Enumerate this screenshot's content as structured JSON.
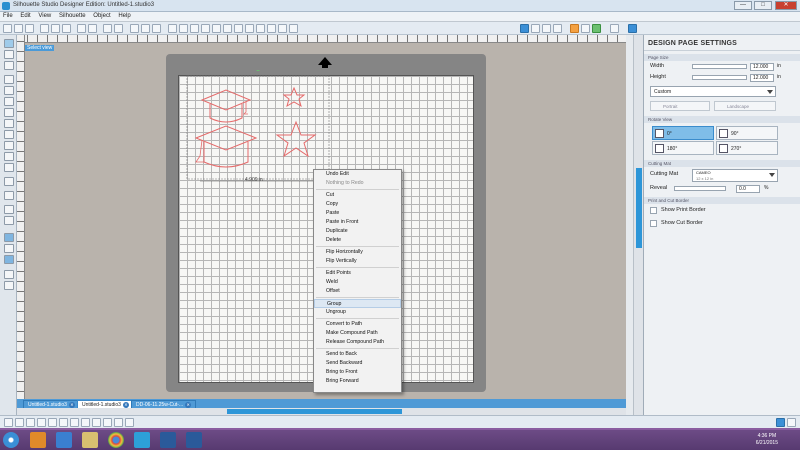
{
  "window": {
    "title": "Silhouette Studio Designer Edition: Untitled-1.studio3",
    "minimize": "—",
    "maximize": "□",
    "close": "✕"
  },
  "menu": [
    "File",
    "Edit",
    "View",
    "Silhouette",
    "Object",
    "Help"
  ],
  "workspace": {
    "view_tag": "Select view",
    "dimension_label": "4.909 in",
    "ruler_top_numbers": [
      "1",
      "2",
      "3",
      "4",
      "5",
      "6",
      "7",
      "8",
      "9",
      "10",
      "11",
      "12",
      "13",
      "14"
    ]
  },
  "context_menu": {
    "items": [
      {
        "label": "Undo Edit",
        "enabled": true
      },
      {
        "label": "Nothing to Redo",
        "enabled": false
      },
      {
        "sep": true
      },
      {
        "label": "Cut",
        "enabled": true
      },
      {
        "label": "Copy",
        "enabled": true
      },
      {
        "label": "Paste",
        "enabled": true
      },
      {
        "label": "Paste in Front",
        "enabled": true
      },
      {
        "label": "Duplicate",
        "enabled": true
      },
      {
        "label": "Delete",
        "enabled": true
      },
      {
        "sep": true
      },
      {
        "label": "Flip Horizontally",
        "enabled": true
      },
      {
        "label": "Flip Vertically",
        "enabled": true
      },
      {
        "sep": true
      },
      {
        "label": "Edit Points",
        "enabled": true
      },
      {
        "label": "Weld",
        "enabled": true
      },
      {
        "label": "Offset",
        "enabled": true
      },
      {
        "sep": true
      },
      {
        "label": "Group",
        "enabled": true,
        "highlighted": true
      },
      {
        "label": "Ungroup",
        "enabled": true
      },
      {
        "sep": true
      },
      {
        "label": "Convert to Path",
        "enabled": true
      },
      {
        "label": "Make Compound Path",
        "enabled": true
      },
      {
        "label": "Release Compound Path",
        "enabled": true
      },
      {
        "sep": true
      },
      {
        "label": "Send to Back",
        "enabled": true
      },
      {
        "label": "Send Backward",
        "enabled": true
      },
      {
        "label": "Bring to Front",
        "enabled": true
      },
      {
        "label": "Bring Forward",
        "enabled": true
      }
    ]
  },
  "tabs": [
    {
      "label": "Untitled-1.studio3",
      "active": false
    },
    {
      "label": "Untitled-1.studio3",
      "active": true
    },
    {
      "label": "DD-06-11.25w-Cut-...",
      "active": false
    }
  ],
  "panel": {
    "title": "DESIGN PAGE SETTINGS",
    "page_size": {
      "header": "Page Size",
      "width_label": "Width",
      "width_value": "12.000",
      "width_unit": "in",
      "height_label": "Height",
      "height_value": "12.000",
      "height_unit": "in",
      "preset": "Custom",
      "portrait": "Portrait",
      "landscape": "Landscape"
    },
    "rotate_view": {
      "header": "Rotate View",
      "options": [
        "0°",
        "90°",
        "180°",
        "270°"
      ],
      "selected": "0°"
    },
    "cutting_mat": {
      "header": "Cutting Mat",
      "label": "Cutting Mat",
      "mat_name": "CAMEO",
      "mat_size": "12 x 12 in",
      "reveal_label": "Reveal",
      "reveal_value": "0.0",
      "reveal_unit": "%"
    },
    "print_cut_border": {
      "header": "Print and Cut Border",
      "show_print": "Show Print Border",
      "show_cut": "Show Cut Border"
    }
  },
  "taskbar": {
    "time": "4:36 PM",
    "date": "6/21/2015"
  },
  "colors": {
    "accent": "#2d96d8",
    "shape_stroke": "#e56a6a",
    "purple_desktop": "#8a5da0"
  }
}
